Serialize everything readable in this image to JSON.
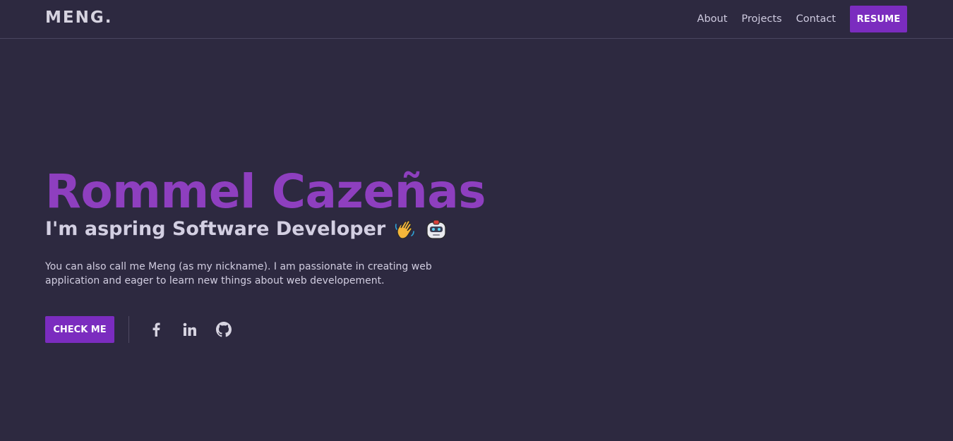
{
  "header": {
    "logo": "MENG.",
    "nav": [
      {
        "label": "About"
      },
      {
        "label": "Projects"
      },
      {
        "label": "Contact"
      }
    ],
    "resume_label": "RESUME"
  },
  "hero": {
    "name": "Rommel Cazeñas",
    "subtitle": "I'm aspring Software Developer",
    "subtitle_emojis": [
      "waving-hand-icon",
      "robot-icon"
    ],
    "description": "You can also call me Meng (as my nickname). I am passionate in creating web application and eager to learn new things about web developement.",
    "cta_label": "CHECK ME",
    "socials": [
      "facebook-icon",
      "linkedin-icon",
      "github-icon"
    ]
  },
  "colors": {
    "background": "#2d2940",
    "accent": "#7b2cbf",
    "name": "#8e3fbf",
    "text": "#d3cfe2"
  }
}
